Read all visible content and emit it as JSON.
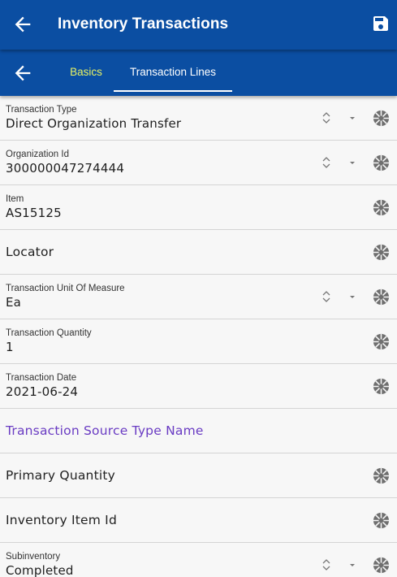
{
  "header": {
    "title": "Inventory Transactions",
    "back_icon": "arrow-left-icon",
    "save_icon": "save-icon"
  },
  "tabs": [
    {
      "label": "Basics",
      "active": false
    },
    {
      "label": "Transaction Lines",
      "active": true
    }
  ],
  "colors": {
    "primary": "#0b4ea2",
    "active_tab_text": "#e8f263",
    "link_text": "#6a3cc3",
    "background": "#f7f7f7"
  },
  "fields": [
    {
      "label": "Transaction Type",
      "value": "Direct Organization Transfer"
    },
    {
      "label": "Organization Id",
      "value": "300000047274444"
    },
    {
      "label": "Item",
      "value": "AS15125"
    },
    {
      "label": "Locator"
    },
    {
      "label": "Transaction Unit Of Measure",
      "value": "Ea"
    },
    {
      "label": "Transaction Quantity",
      "value": "1"
    },
    {
      "label": "Transaction Date",
      "value": "2021-06-24"
    },
    {
      "label": "Transaction Source Type Name"
    },
    {
      "label": "Primary Quantity"
    },
    {
      "label": "Inventory Item Id"
    },
    {
      "label": "Subinventory",
      "value": "Completed"
    }
  ],
  "icons": {
    "sort": "unfold-icon",
    "dropdown": "chevron-down-icon",
    "lookup": "aperture-icon"
  }
}
